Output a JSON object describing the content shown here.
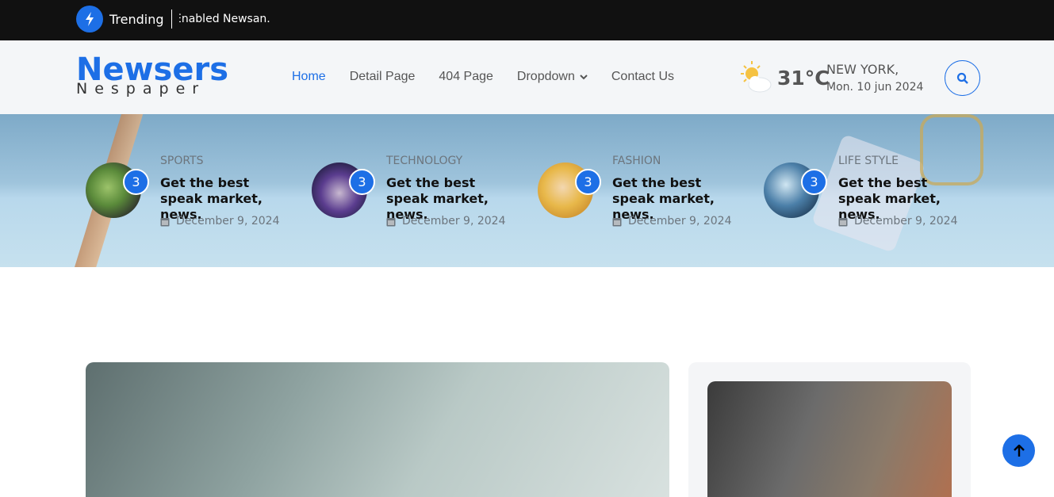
{
  "topbar": {
    "trending_label": "Trending",
    "ticker_text": "Enabled Newsan."
  },
  "header": {
    "logo_title": "Newsers",
    "logo_subtitle": "Nespaper",
    "nav": [
      {
        "label": "Home",
        "active": true
      },
      {
        "label": "Detail Page",
        "active": false
      },
      {
        "label": "404 Page",
        "active": false
      },
      {
        "label": "Dropdown",
        "active": false
      },
      {
        "label": "Contact Us",
        "active": false
      }
    ],
    "weather": {
      "temperature": "31°C",
      "city": "NEW YORK,",
      "date": "Mon. 10 jun 2024"
    }
  },
  "stories": [
    {
      "category": "SPORTS",
      "title": "Get the best speak market, news.",
      "date": "December 9, 2024",
      "count": "3"
    },
    {
      "category": "TECHNOLOGY",
      "title": "Get the best speak market, news.",
      "date": "December 9, 2024",
      "count": "3"
    },
    {
      "category": "FASHION",
      "title": "Get the best speak market, news.",
      "date": "December 9, 2024",
      "count": "3"
    },
    {
      "category": "LIFE STYLE",
      "title": "Get the best speak market, news.",
      "date": "December 9, 2024",
      "count": "3"
    }
  ],
  "colors": {
    "accent": "#1d6fe6",
    "topbar_bg": "#111111",
    "header_bg": "#f4f6f8"
  },
  "icons": [
    "bolt-icon",
    "chevron-down-icon",
    "weather-sun-cloud-icon",
    "search-icon",
    "calendar-icon",
    "arrow-up-icon"
  ]
}
